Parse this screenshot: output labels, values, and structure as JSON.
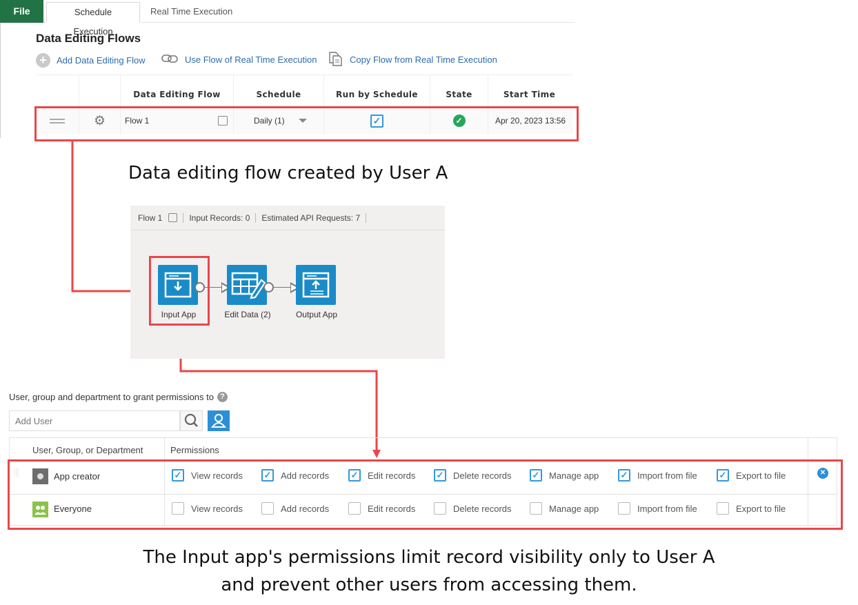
{
  "tabs": {
    "file": "File",
    "schedule": "Schedule Execution",
    "realtime": "Real Time Execution"
  },
  "section_title": "Data Editing Flows",
  "actions": {
    "add": "Add Data Editing Flow",
    "use": "Use Flow of Real Time Execution",
    "copy": "Copy Flow from Real Time Execution"
  },
  "flow_table": {
    "headers": [
      "Data Editing Flow",
      "Schedule",
      "Run by Schedule",
      "State",
      "Start Time"
    ],
    "row": {
      "name": "Flow 1",
      "schedule": "Daily (1)",
      "run_by_schedule": true,
      "start_time": "Apr 20, 2023 13:56"
    }
  },
  "caption_top": "Data editing flow created by User A",
  "canvas": {
    "flow_name": "Flow 1",
    "input_records": "Input Records: 0",
    "api_requests": "Estimated API Requests: 7",
    "nodes": [
      "Input App",
      "Edit Data (2)",
      "Output App"
    ]
  },
  "permissions": {
    "title": "User, group and department to grant permissions to",
    "help": "?",
    "add_user_placeholder": "Add User",
    "col_user": "User, Group, or Department",
    "col_permissions": "Permissions",
    "labels": [
      "View records",
      "Add records",
      "Edit records",
      "Delete records",
      "Manage app",
      "Import from file",
      "Export to file"
    ],
    "rows": [
      {
        "name": "App creator",
        "checked": [
          true,
          true,
          true,
          true,
          true,
          true,
          true
        ]
      },
      {
        "name": "Everyone",
        "checked": [
          false,
          false,
          false,
          false,
          false,
          false,
          false
        ]
      }
    ]
  },
  "caption_bottom": {
    "line1": "The Input app's permissions limit record visibility only to User A",
    "line2": "and prevent other users from accessing them."
  },
  "colors": {
    "accent_red": "#e8474a",
    "brand_green": "#217346",
    "node_blue": "#1a8bc7",
    "link_blue": "#2b6cb0"
  }
}
